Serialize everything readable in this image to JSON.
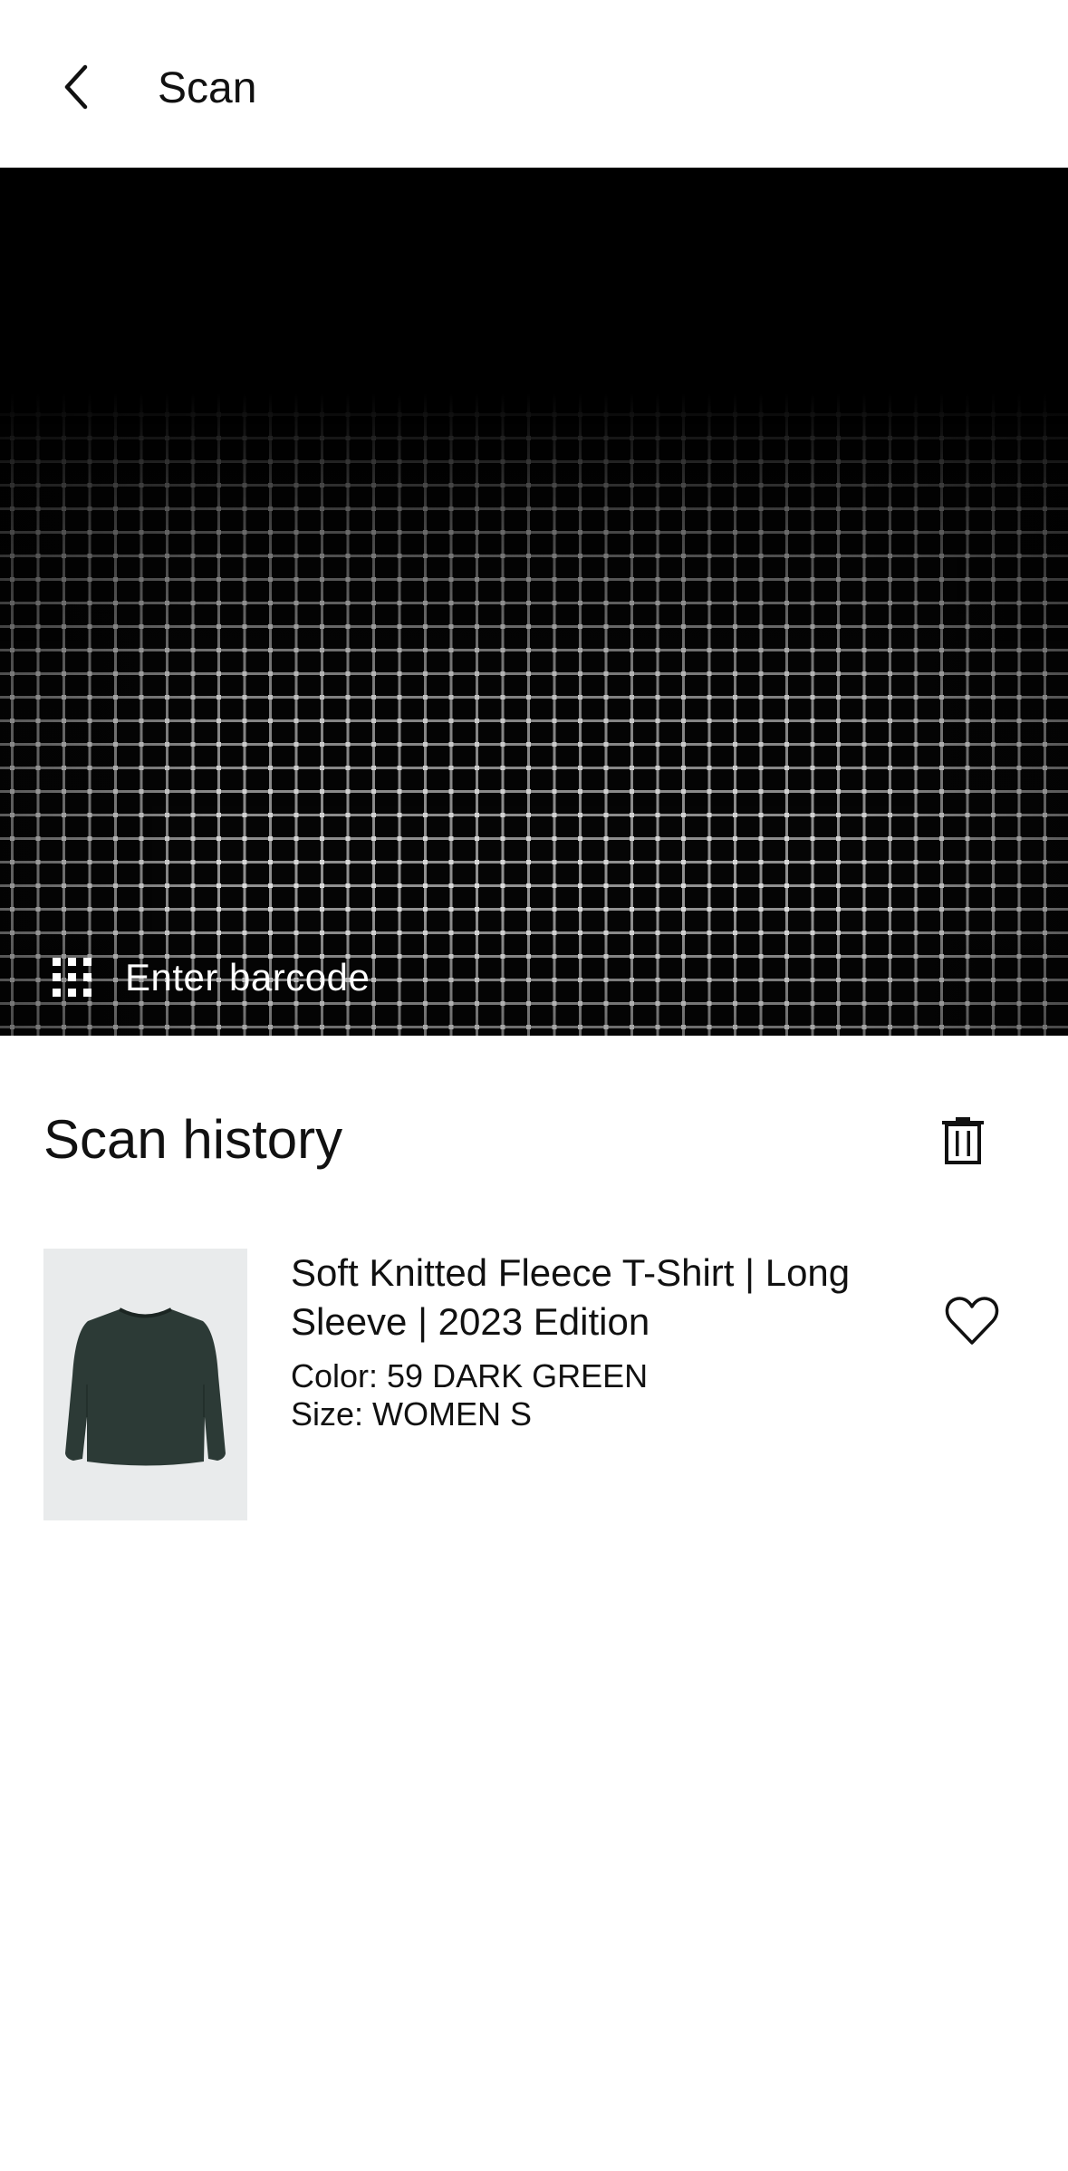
{
  "header": {
    "back_icon": "chevron-left-icon",
    "title": "Scan"
  },
  "scanner": {
    "barcode_icon": "grid-dots-icon",
    "enter_barcode_label": "Enter barcode"
  },
  "history": {
    "title": "Scan history",
    "delete_icon": "trash-icon",
    "items": [
      {
        "name": "Soft Knitted Fleece T-Shirt | Long Sleeve | 2023 Edition",
        "color": "Color: 59 DARK GREEN",
        "size": "Size: WOMEN S",
        "favorite_icon": "heart-outline-icon",
        "product_color": "#2c3a36"
      }
    ]
  }
}
